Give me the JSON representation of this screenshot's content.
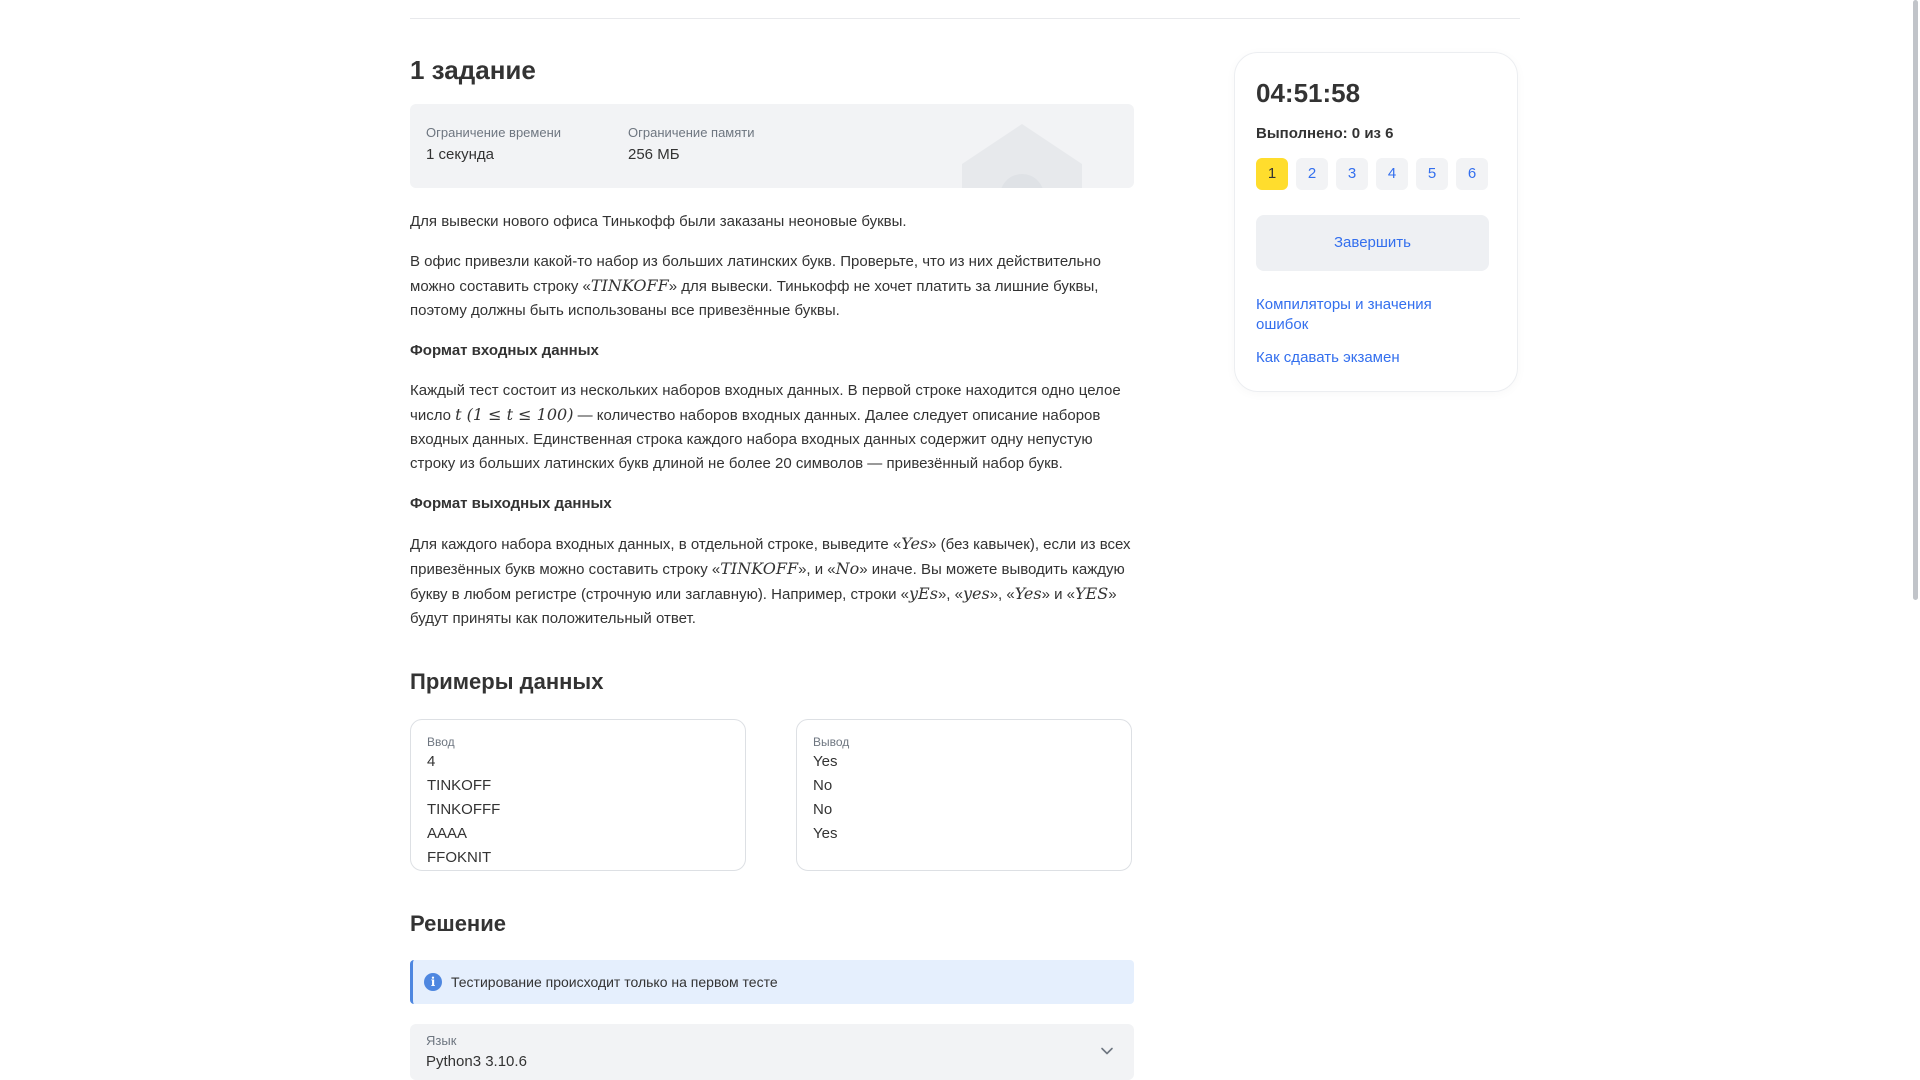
{
  "task": {
    "title": "1 задание",
    "time_limit_label": "Ограничение времени",
    "time_limit_value": "1 секунда",
    "memory_limit_label": "Ограничение памяти",
    "memory_limit_value": "256 МБ"
  },
  "statement": {
    "p1": "Для вывески нового офиса Тинькофф были заказаны неоновые буквы.",
    "p2_a": "В офис привезли какой-то набор из больших латинских букв. Проверьте, что из них действительно можно составить строку «",
    "p2_m1": "TINKOFF",
    "p2_b": "» для вывески. Тинькофф не хочет платить за лишние буквы, поэтому должны быть использованы все привезённые буквы.",
    "input_heading": "Формат входных данных",
    "p3_a": "Каждый тест состоит из нескольких наборов входных данных. В первой строке находится одно целое число ",
    "p3_m1": "t (1 ≤ t ≤ 100)",
    "p3_b": " — количество наборов входных данных. Далее следует описание наборов входных данных. Единственная строка каждого набора входных данных содержит одну непустую строку из больших латинских букв длиной не более 20 символов — привезённый набор букв.",
    "output_heading": "Формат выходных данных",
    "p4_a": "Для каждого набора входных данных, в отдельной строке, выведите «",
    "p4_m1": "Yes",
    "p4_b": "» (без кавычек), если из всех привезённых букв можно составить строку «",
    "p4_m2": "TINKOFF",
    "p4_c": "», и «",
    "p4_m3": "No",
    "p4_d": "» иначе. Вы можете выводить каждую букву в любом регистре (строчную или заглавную). Например, строки «",
    "p4_m4": "yEs",
    "p4_e": "», «",
    "p4_m5": "yes",
    "p4_f": "», «",
    "p4_m6": "Yes",
    "p4_g": "» и «",
    "p4_m7": "YES",
    "p4_h": "» будут приняты как положительный ответ."
  },
  "examples": {
    "title": "Примеры данных",
    "input_label": "Ввод",
    "input_lines": [
      "4",
      "TINKOFF",
      "TINKOFFF",
      "AAAA",
      "FFOKNIT"
    ],
    "output_label": "Вывод",
    "output_lines": [
      "Yes",
      "No",
      "No",
      "Yes"
    ]
  },
  "solution": {
    "title": "Решение",
    "notice": "Тестирование происходит только на первом тесте",
    "language_label": "Язык",
    "language_value": "Python3 3.10.6"
  },
  "sidebar": {
    "timer": "04:51:58",
    "progress": "Выполнено: 0 из 6",
    "tasks": [
      "1",
      "2",
      "3",
      "4",
      "5",
      "6"
    ],
    "active_task": "1",
    "finish_label": "Завершить",
    "link_compilers": "Компиляторы и значения ошибок",
    "link_exam": "Как сдавать экзамен"
  },
  "colors": {
    "accent_yellow": "#ffdd2d",
    "link_blue": "#336fee",
    "panel_gray": "#f2f3f5",
    "notice_blue": "#e5effd"
  },
  "icons": [
    "info-icon",
    "chevron-down-icon"
  ]
}
